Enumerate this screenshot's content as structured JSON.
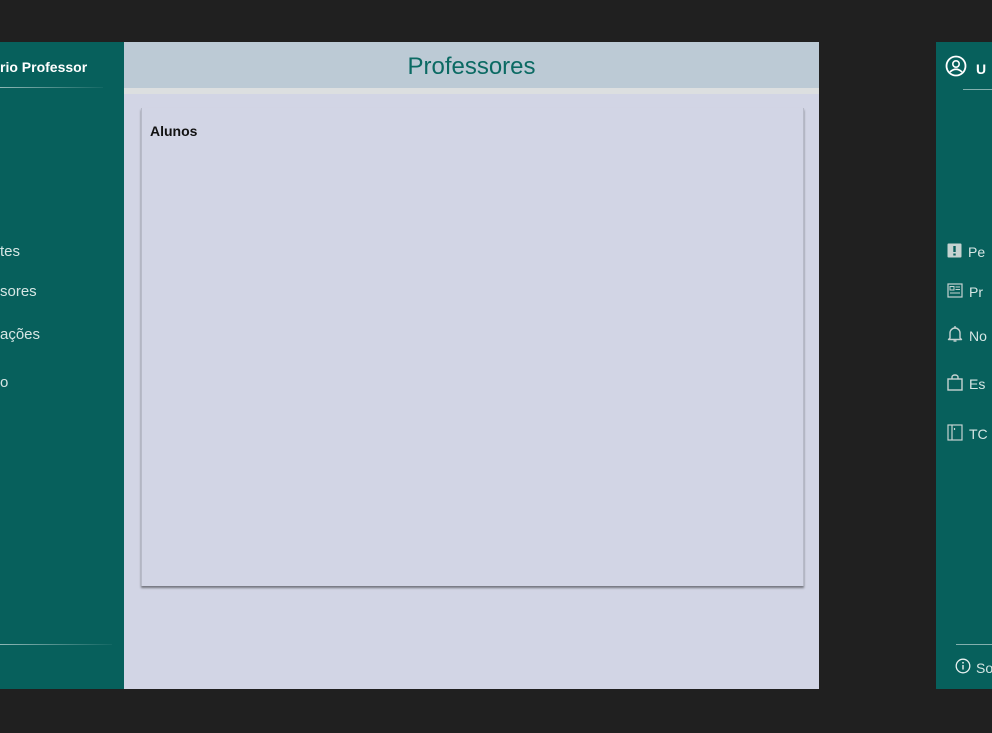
{
  "left_panel": {
    "title": "rio Professor",
    "nav_items": [
      "tes",
      "sores",
      "ações",
      "o"
    ]
  },
  "main": {
    "page_title": "Professores",
    "card_title": "Alunos"
  },
  "right_panel": {
    "user_label": "U",
    "nav_items": [
      "Pe",
      "Pr",
      "No",
      "Es",
      "TC"
    ],
    "footer_label": "So"
  },
  "colors": {
    "sidebar": "#07605c",
    "header": "#bccad5",
    "content": "#d2d5e5",
    "title_text": "#0b6a63",
    "background": "#202020"
  },
  "icons": {
    "user": "user-circle-icon",
    "pending": "alert-square-icon",
    "profile": "id-card-icon",
    "notifications": "bell-icon",
    "store": "bag-icon",
    "tcc": "book-icon",
    "about": "info-icon"
  }
}
